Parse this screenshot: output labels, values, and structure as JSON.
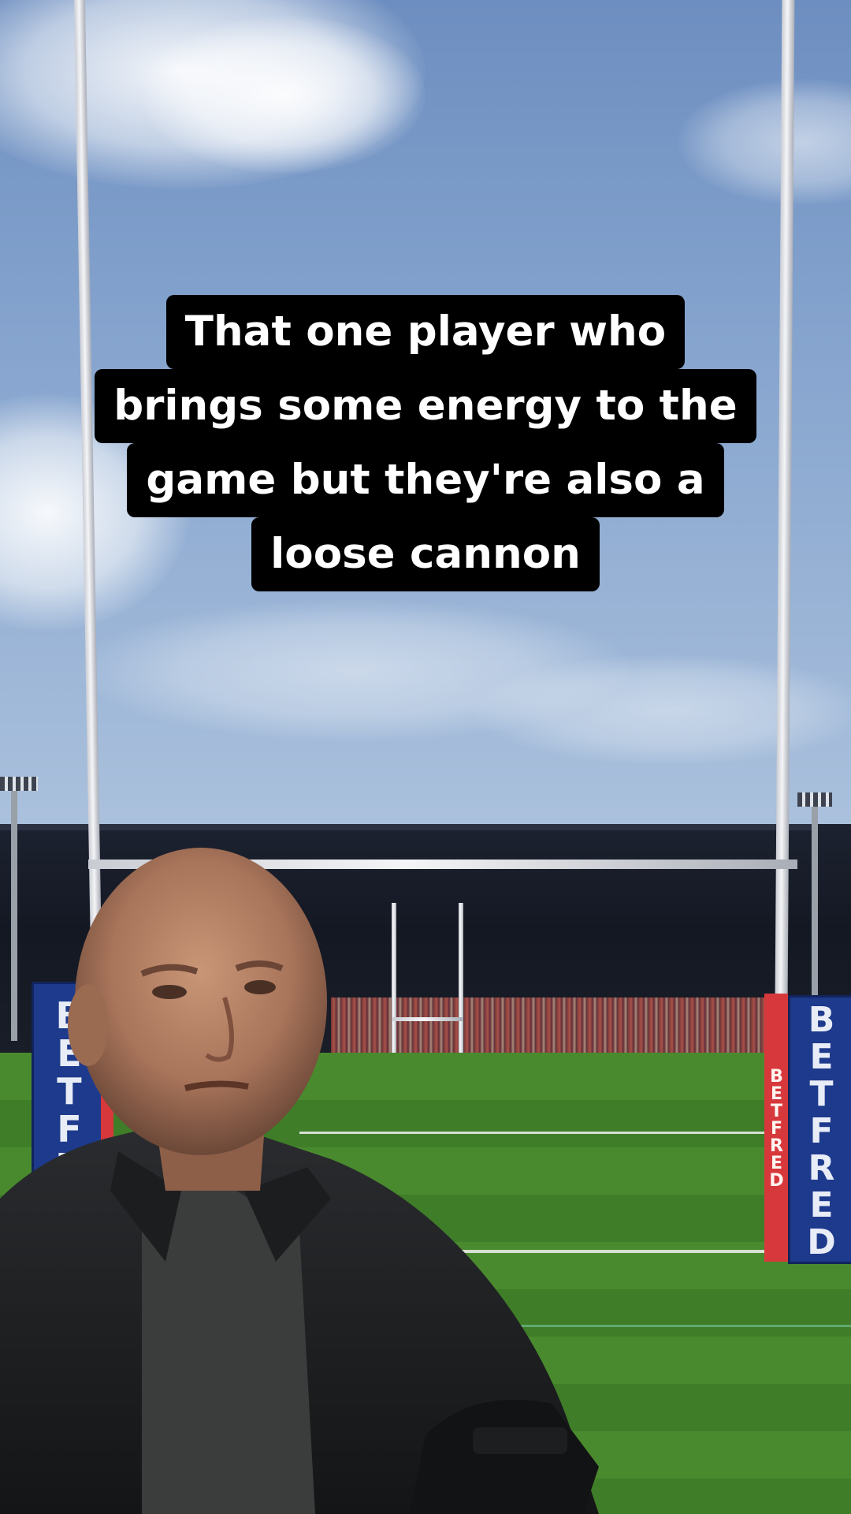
{
  "caption": {
    "lines": [
      "That one player who",
      "brings some energy to the",
      "game but they're also a",
      "loose cannon"
    ]
  },
  "scene": {
    "pad_left_text": "BETFR",
    "pad_right_text": "BETFRED",
    "pad_right_side_text": "BETFRED",
    "pad_left_side_text": "BETF",
    "colors": {
      "sky": "#88a6cf",
      "pitch": "#4a8a2e",
      "pad_blue": "#1e3a8c",
      "pad_red": "#d7383b",
      "caption_bg": "#000000",
      "caption_text": "#ffffff"
    }
  }
}
